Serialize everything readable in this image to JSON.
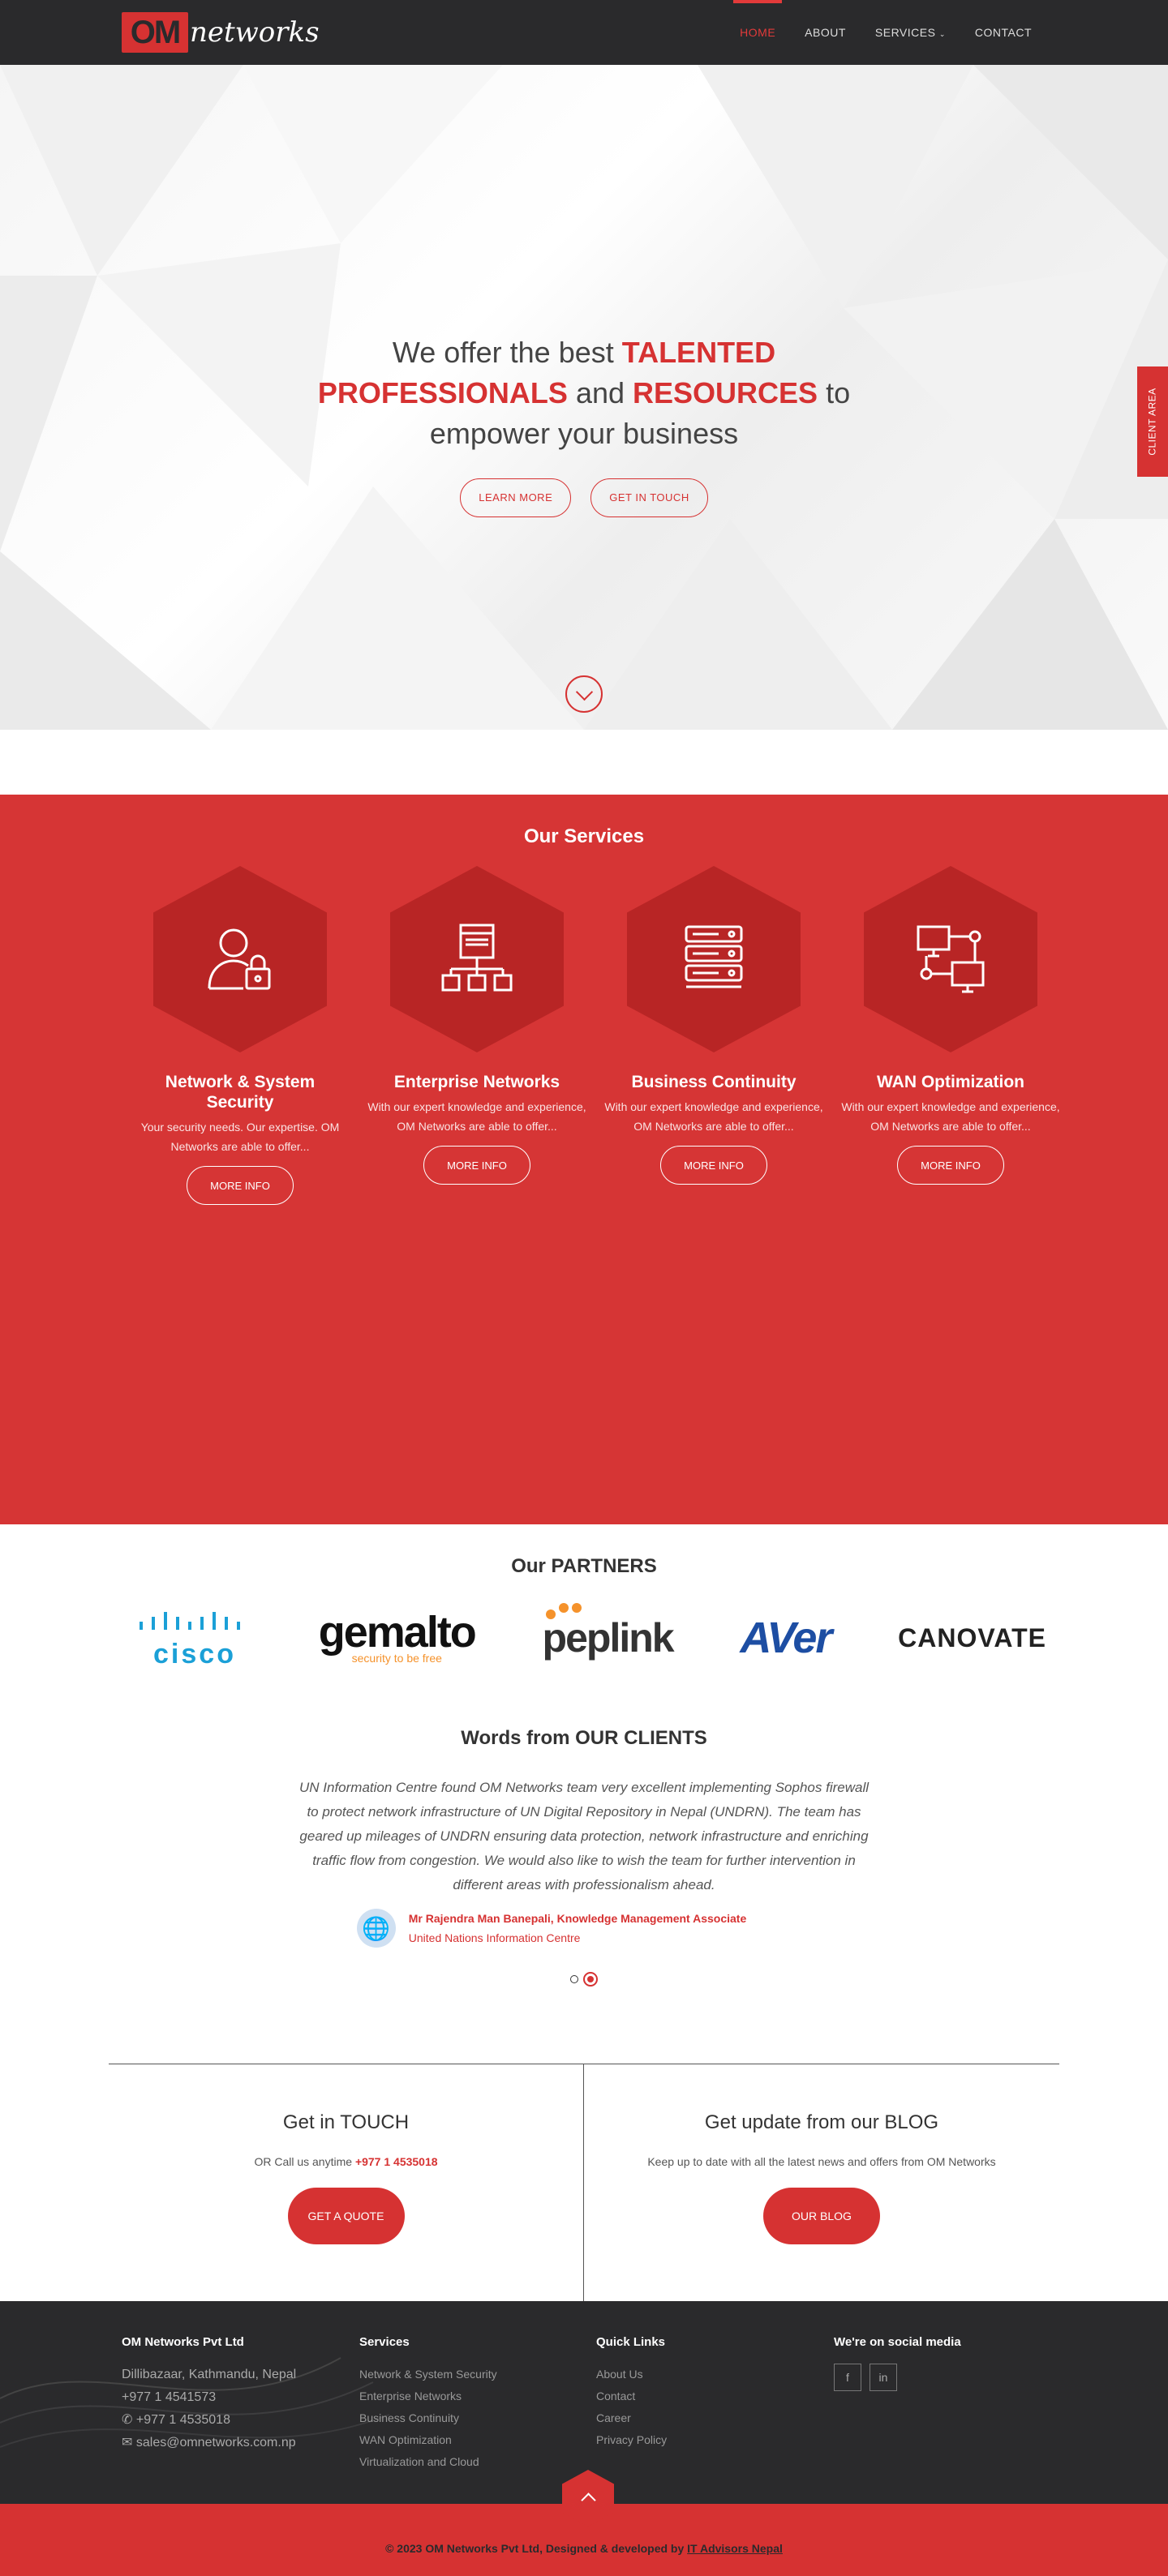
{
  "nav": {
    "logo_om": "OM",
    "logo_net": "networks",
    "items": [
      {
        "label": "HOME"
      },
      {
        "label": "ABOUT"
      },
      {
        "label": "SERVICES"
      },
      {
        "label": "CONTACT"
      }
    ]
  },
  "hero": {
    "t1": "We offer the best ",
    "t2": "TALENTED PROFESSIONALS",
    "t3": " and ",
    "t4": "RESOURCES",
    "t5": " to empower your business",
    "btn1": "LEARN MORE",
    "btn2": "GET IN TOUCH"
  },
  "client_tab": "CLIENT AREA",
  "services": {
    "title": "Our Services",
    "items": [
      {
        "title": "Network & System Security",
        "desc": "Your security needs. Our expertise. OM Networks are able to offer...",
        "btn": "MORE INFO",
        "icon": "user-lock-icon"
      },
      {
        "title": "Enterprise Networks",
        "desc": "With our expert knowledge and experience, OM Networks are able to offer...",
        "btn": "MORE INFO",
        "icon": "network-hierarchy-icon"
      },
      {
        "title": "Business Continuity",
        "desc": "With our expert knowledge and experience, OM Networks are able to offer...",
        "btn": "MORE INFO",
        "icon": "server-stack-icon"
      },
      {
        "title": "WAN Optimization",
        "desc": "With our expert knowledge and experience, OM Networks are able to offer...",
        "btn": "MORE INFO",
        "icon": "computers-network-icon"
      }
    ]
  },
  "partners": {
    "title": "Our PARTNERS",
    "logos": [
      "cisco",
      "gemalto",
      "security to be free",
      "peplink",
      "AVer",
      "CANOVATE"
    ]
  },
  "testimonial": {
    "title": "Words from OUR CLIENTS",
    "quote": "UN Information Centre found OM Networks team very excellent implementing Sophos firewall to protect network infrastructure of UN Digital Repository in Nepal (UNDRN). The team has geared up mileages of UNDRN ensuring data protection, network infrastructure and enriching traffic flow from congestion. We would also like to wish the team for further intervention in different areas with professionalism ahead.",
    "author": "Mr Rajendra Man Banepali, Knowledge Management Associate",
    "org": "United Nations Information Centre"
  },
  "cta": {
    "left_title": "Get in TOUCH",
    "left_text": "OR Call us anytime ",
    "left_phone": "+977 1 4535018",
    "left_btn": "GET A QUOTE",
    "right_title": "Get update from our BLOG",
    "right_text": "Keep up to date with all the latest news and offers from OM Networks",
    "right_btn": "OUR BLOG"
  },
  "footer": {
    "company": "OM Networks Pvt Ltd",
    "address": "Dillibazaar, Kathmandu, Nepal",
    "phone1": "+977 1 4541573",
    "phone2": "+977 1 4535018",
    "email": "sales@omnetworks.com.np",
    "services_title": "Services",
    "services": [
      "Network & System Security",
      "Enterprise Networks",
      "Business Continuity",
      "WAN Optimization",
      "Virtualization and Cloud"
    ],
    "links_title": "Quick Links",
    "links": [
      "About Us",
      "Contact",
      "Career",
      "Privacy Policy"
    ],
    "social_title": "We're on social media",
    "copyright": "© 2023 OM Networks Pvt Ltd, Designed & developed by ",
    "dev": "IT Advisors Nepal"
  },
  "colors": {
    "brand": "#d63232",
    "dark": "#2a2a2c"
  }
}
